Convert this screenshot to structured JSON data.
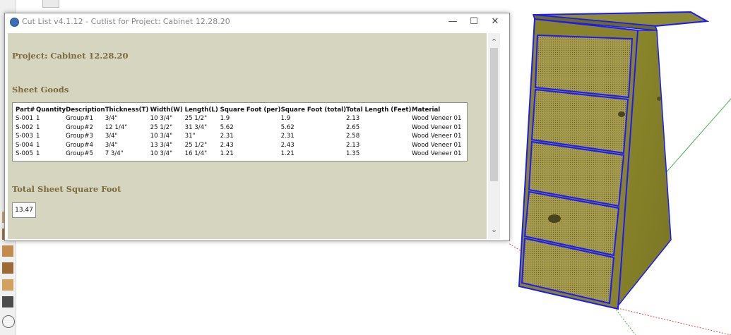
{
  "window": {
    "title": "Cut List v4.1.12 -  Cutlist for Project: Cabinet 12.28.20",
    "minimize_glyph": "—",
    "maximize_glyph": "☐",
    "close_glyph": "✕"
  },
  "report": {
    "project_heading": "Project: Cabinet 12.28.20",
    "sheet_goods_heading": "Sheet Goods",
    "total_heading": "Total Sheet Square Foot",
    "total_value": "13.47"
  },
  "table": {
    "columns": [
      "Part#",
      "Quantity",
      "Description",
      "Thickness(T)",
      "Width(W)",
      "Length(L)",
      "Square Foot (per)",
      "Square Foot (total)",
      "Total Length (Feet)",
      "Material"
    ],
    "rows": [
      [
        "S-001",
        "1",
        "Group#1",
        "3/4\"",
        "10 3/4\"",
        "25 1/2\"",
        "1.9",
        "1.9",
        "2.13",
        "Wood Veneer 01"
      ],
      [
        "S-002",
        "1",
        "Group#2",
        "12 1/4\"",
        "25 1/2\"",
        "31 3/4\"",
        "5.62",
        "5.62",
        "2.65",
        "Wood Veneer 01"
      ],
      [
        "S-003",
        "1",
        "Group#3",
        "3/4\"",
        "10 3/4\"",
        "31\"",
        "2.31",
        "2.31",
        "2.58",
        "Wood Veneer 01"
      ],
      [
        "S-004",
        "1",
        "Group#4",
        "3/4\"",
        "13 3/4\"",
        "25 1/2\"",
        "2.43",
        "2.43",
        "2.13",
        "Wood Veneer 01"
      ],
      [
        "S-005",
        "1",
        "Group#5",
        "7 3/4\"",
        "10 3/4\"",
        "16 1/4\"",
        "1.21",
        "1.21",
        "1.35",
        "Wood Veneer 01"
      ]
    ]
  },
  "scrollbar": {
    "up_glyph": "⌃",
    "down_glyph": "⌄"
  },
  "colors": {
    "report_background": "#d6d5c0",
    "heading_text": "#7c6a3e",
    "selection_edges": "#1a1aff",
    "wood": "#8f8a2e"
  },
  "icons": [
    "app-icon",
    "minimize-icon",
    "maximize-icon",
    "close-icon",
    "scroll-up-icon",
    "scroll-down-icon"
  ]
}
